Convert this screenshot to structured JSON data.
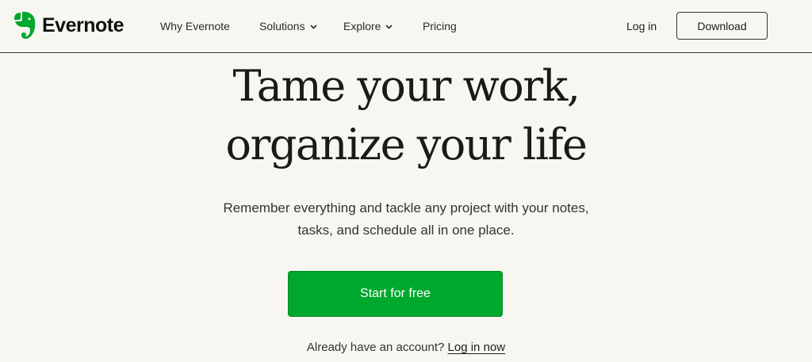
{
  "header": {
    "logo_text": "Evernote",
    "logo_icon": "elephant-icon",
    "nav": {
      "why": "Why Evernote",
      "solutions": "Solutions",
      "explore": "Explore",
      "pricing": "Pricing"
    },
    "login_label": "Log in",
    "download_label": "Download"
  },
  "hero": {
    "title_line1": "Tame your work,",
    "title_line2": "organize your life",
    "subtitle_line1": "Remember everything and tackle any project with your notes,",
    "subtitle_line2": "tasks, and schedule all in one place.",
    "cta_label": "Start for free",
    "account_prompt": "Already have an account?",
    "account_link": "Log in now"
  },
  "colors": {
    "background": "#f8f6f1",
    "brand_green": "#00a82d",
    "text": "#1c1c1c"
  }
}
